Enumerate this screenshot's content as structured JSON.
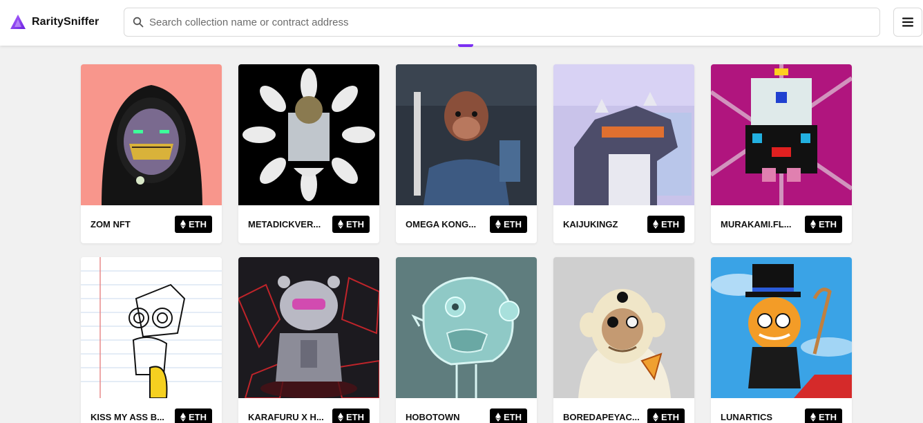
{
  "brand": {
    "name": "RaritySniffer",
    "logo_icon": "triangle-logo-icon",
    "accent": "#7b2ff2"
  },
  "search": {
    "placeholder": "Search collection name or contract address",
    "value": "",
    "icon": "search-icon"
  },
  "menu": {
    "icon": "hamburger-menu-icon"
  },
  "collections": [
    {
      "name": "ZOM NFT",
      "display": "ZOM NFT",
      "chain": "ETH",
      "thumb_bg": "#f8968c"
    },
    {
      "name": "METADICKVERSE",
      "display": "METADICKVER...",
      "chain": "ETH",
      "thumb_bg": "#000000"
    },
    {
      "name": "OMEGA KONGZ",
      "display": "OMEGA KONG...",
      "chain": "ETH",
      "thumb_bg": "#2d3540"
    },
    {
      "name": "KAIJUKINGZ",
      "display": "KAIJUKINGZ",
      "chain": "ETH",
      "thumb_bg": "#c9c3ea"
    },
    {
      "name": "MURAKAMI.FLOWERS",
      "display": "MURAKAMI.FL...",
      "chain": "ETH",
      "thumb_bg": "#b0157e"
    },
    {
      "name": "KISS MY ASS BY",
      "display": "KISS MY ASS B...",
      "chain": "ETH",
      "thumb_bg": "#ffffff"
    },
    {
      "name": "KARAFURU X HYPEBEAST",
      "display": "KARAFURU X H...",
      "chain": "ETH",
      "thumb_bg": "#1c1a1f"
    },
    {
      "name": "HOBOTOWN",
      "display": "HOBOTOWN",
      "chain": "ETH",
      "thumb_bg": "#5f7d7e"
    },
    {
      "name": "BOREDAPEYACHTCLUB",
      "display": "BOREDAPEYAC...",
      "chain": "ETH",
      "thumb_bg": "#cfcfcf"
    },
    {
      "name": "LUNARTICS",
      "display": "LUNARTICS",
      "chain": "ETH",
      "thumb_bg": "#3aa3e6"
    }
  ]
}
